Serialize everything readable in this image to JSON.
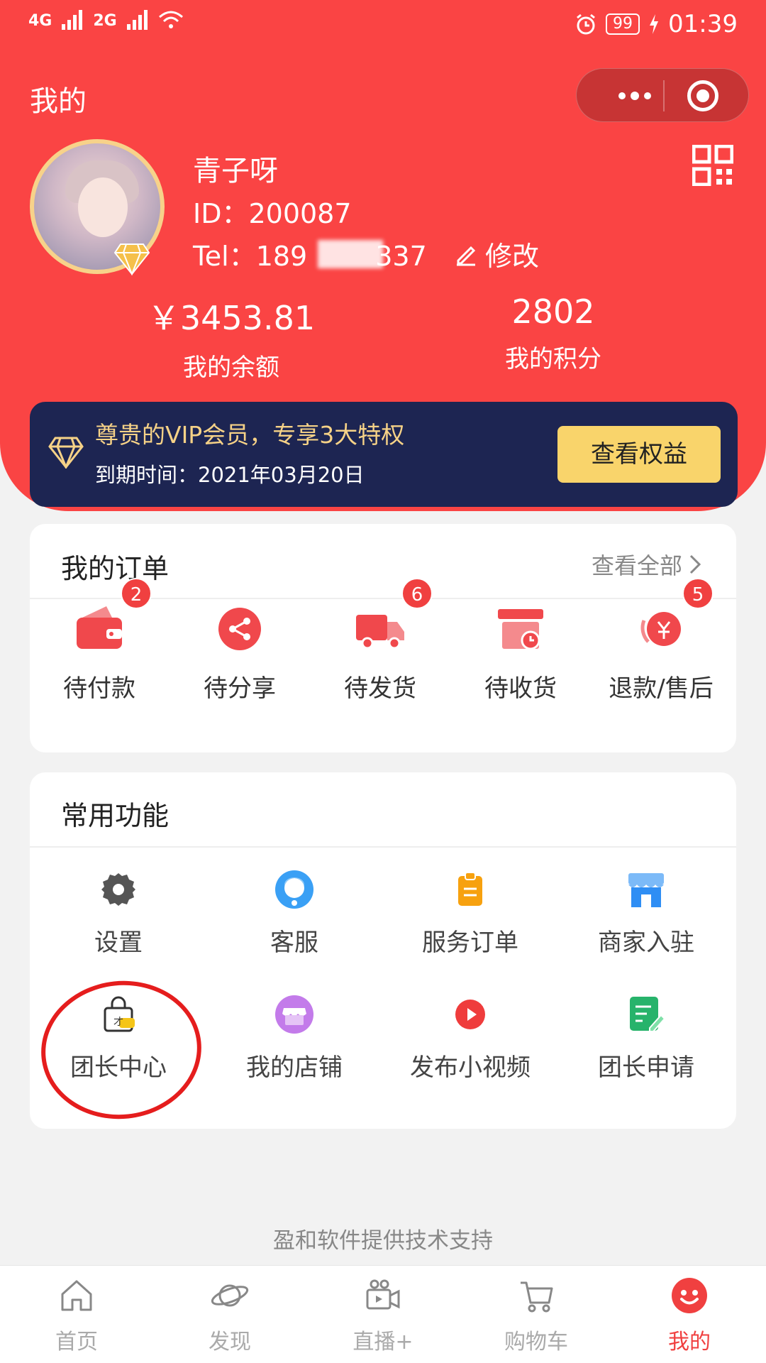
{
  "status_bar": {
    "signal1": "4G",
    "signal2": "2G",
    "battery": "99",
    "time": "01:39"
  },
  "header": {
    "title": "我的",
    "user": {
      "name": "青子呀",
      "id": "ID：200087",
      "tel_prefix": "Tel：189",
      "tel_suffix": "337",
      "edit_label": "修改"
    },
    "balance": {
      "value": "￥3453.81",
      "label": "我的余额"
    },
    "points": {
      "value": "2802",
      "label": "我的积分"
    },
    "vip": {
      "title": "尊贵的VIP会员，专享3大特权",
      "expiry": "到期时间：2021年03月20日",
      "button": "查看权益"
    }
  },
  "orders": {
    "title": "我的订单",
    "see_all": "查看全部",
    "items": [
      {
        "label": "待付款",
        "badge": "2",
        "icon": "wallet-icon"
      },
      {
        "label": "待分享",
        "badge": "",
        "icon": "share-icon"
      },
      {
        "label": "待发货",
        "badge": "6",
        "icon": "truck-icon"
      },
      {
        "label": "待收货",
        "badge": "",
        "icon": "receive-box-icon"
      },
      {
        "label": "退款/售后",
        "badge": "5",
        "icon": "refund-icon"
      }
    ]
  },
  "functions": {
    "title": "常用功能",
    "items": [
      {
        "label": "设置",
        "icon": "gear-icon",
        "color": "#555555"
      },
      {
        "label": "客服",
        "icon": "customer-service-icon",
        "color": "#3aa0f5"
      },
      {
        "label": "服务订单",
        "icon": "clipboard-icon",
        "color": "#f7a10f"
      },
      {
        "label": "商家入驻",
        "icon": "store-icon",
        "color": "#2f8ef4"
      },
      {
        "label": "团长中心",
        "icon": "shopping-bag-icon",
        "color": "#f5c518"
      },
      {
        "label": "我的店铺",
        "icon": "shop-icon",
        "color": "#c37bea"
      },
      {
        "label": "发布小视频",
        "icon": "play-icon",
        "color": "#ef3c3c"
      },
      {
        "label": "团长申请",
        "icon": "edit-form-icon",
        "color": "#27b36b"
      }
    ]
  },
  "footer_note": "盈和软件提供技术支持",
  "tabbar": [
    {
      "label": "首页",
      "icon": "home-icon",
      "active": false
    },
    {
      "label": "发现",
      "icon": "planet-icon",
      "active": false
    },
    {
      "label": "直播+",
      "icon": "video-camera-icon",
      "active": false
    },
    {
      "label": "购物车",
      "icon": "cart-icon",
      "active": false
    },
    {
      "label": "我的",
      "icon": "smiley-icon",
      "active": true
    }
  ],
  "colors": {
    "brand_red": "#fa4444",
    "vip_navy": "#1d2552",
    "vip_gold": "#f6d287",
    "badge_red": "#f04040"
  }
}
